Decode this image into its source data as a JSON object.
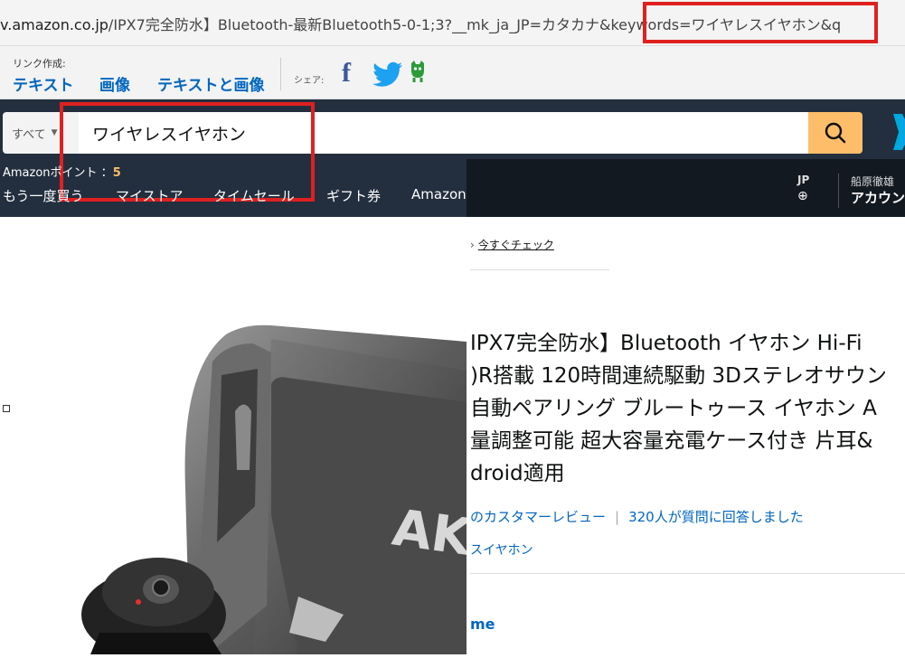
{
  "browser": {
    "url_prefix": "/IPX7完全防水】Bluetooth-最新Bluetooth5-0-1",
    "url_host": "v.amazon.co.jp",
    "url_middle": ";3?__mk_ja_JP=カタカナ",
    "url_highlight": "&keywords=ワイヤレスイヤホン&q"
  },
  "associates": {
    "link_label": "リンク作成:",
    "options": [
      "テキスト",
      "画像",
      "テキストと画像"
    ],
    "share_label": "シェア:",
    "share_icons": [
      "facebook-icon",
      "twitter-icon",
      "line-icon"
    ]
  },
  "header": {
    "department": "すべて",
    "search_value": "ワイヤレスイヤホン",
    "points_label": "Amazonポイント ：",
    "points_value": "5",
    "nav_links": [
      "もう一度買う",
      "マイストア",
      "タイムセール",
      "ギフト券",
      "Amazon"
    ],
    "lang_code": "JP",
    "lang_icon": "globe-icon",
    "account_greeting": "船原徹雄",
    "account_label": "アカウン"
  },
  "product": {
    "breadcrumb_link": "今すぐチェック",
    "title_lines": [
      "IPX7完全防水】Bluetooth イヤホン Hi-Fi",
      ")R搭載 120時間連続駆動 3Dステレオサウン",
      "自動ペアリング ブルートゥース イヤホン A",
      "量調整可能 超大容量充電ケース付き 片耳&",
      "droid適用"
    ],
    "reviews_text": "のカスタマーレビュー",
    "answers_text": "320人が質問に回答しました",
    "brand_text": "スイヤホン",
    "prime_text": "me",
    "image_logo_text": "AK"
  },
  "colors": {
    "nav_bg": "#232f3e",
    "search_button": "#febd69",
    "highlight": "#e02020",
    "link": "#0066c0"
  }
}
